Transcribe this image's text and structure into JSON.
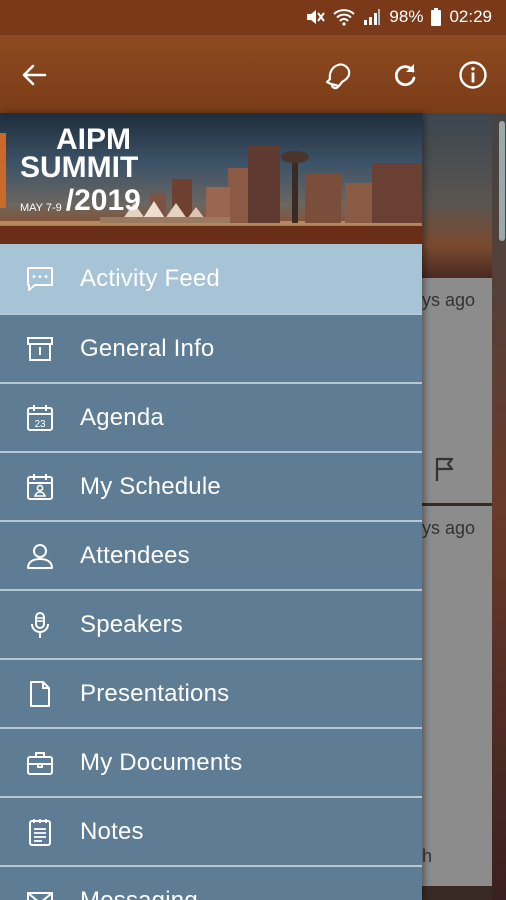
{
  "status_bar": {
    "battery": "98%",
    "time": "02:29"
  },
  "app_bar": {
    "back_icon": "arrow-left-icon",
    "actions": [
      "bell-icon",
      "refresh-icon",
      "info-icon"
    ]
  },
  "banner": {
    "line1": "AIPM",
    "line2": "SUMMIT",
    "dates": "MAY 7-9",
    "year": "/2019"
  },
  "menu": {
    "items": [
      {
        "label": "Activity Feed",
        "icon": "chat-icon",
        "active": true
      },
      {
        "label": "General Info",
        "icon": "archive-icon"
      },
      {
        "label": "Agenda",
        "icon": "calendar-icon",
        "icon_text": "23"
      },
      {
        "label": "My Schedule",
        "icon": "calendar-person-icon"
      },
      {
        "label": "Attendees",
        "icon": "person-icon"
      },
      {
        "label": "Speakers",
        "icon": "microphone-icon"
      },
      {
        "label": "Presentations",
        "icon": "document-icon"
      },
      {
        "label": "My Documents",
        "icon": "briefcase-icon"
      },
      {
        "label": "Notes",
        "icon": "notepad-icon"
      },
      {
        "label": "Messaging",
        "icon": "envelope-icon"
      }
    ]
  },
  "background": {
    "card1_time": "ys ago",
    "card2_time": "ys ago",
    "card2_fragment": "h"
  },
  "colors": {
    "app_bar": "#8e4a20",
    "drawer": "#5e7d94",
    "active_item": "#a7c3d6"
  }
}
